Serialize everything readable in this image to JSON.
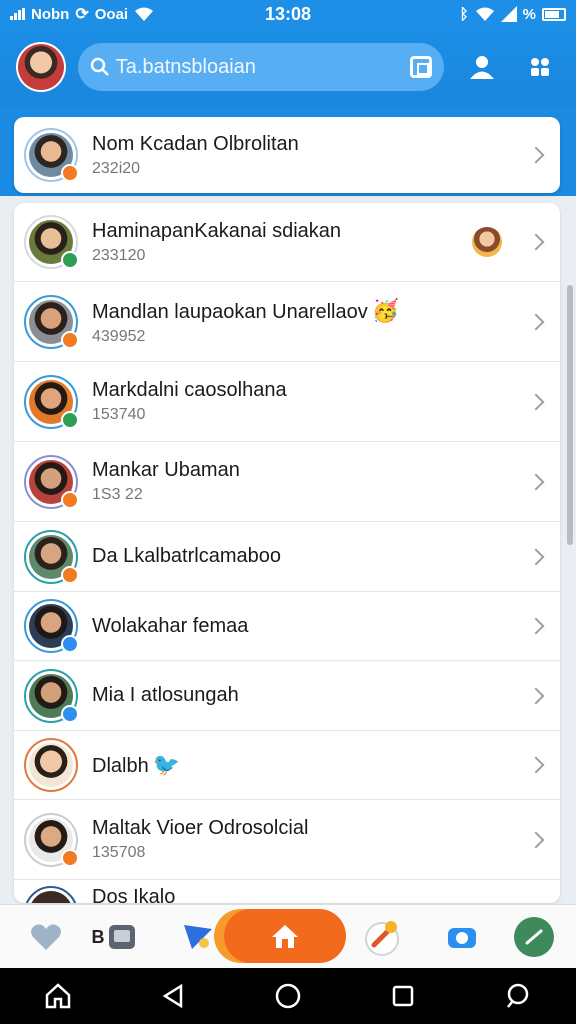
{
  "status_bar": {
    "carrier": "Nobn",
    "carrier2": "Ooai",
    "time": "13:08",
    "battery_text": "%"
  },
  "header": {
    "search_text": "Ta.batnsbloaian"
  },
  "pinned": {
    "name": "Nom Kcadan Olbrolitan",
    "sub": "232i20"
  },
  "contacts": [
    {
      "name": "HaminapanKakanai sdiakan",
      "sub": "233120"
    },
    {
      "name": "Mandlan laupaokan Unarellaov",
      "sub": "439952"
    },
    {
      "name": "Markdalni caosolhana",
      "sub": "153740"
    },
    {
      "name": "Mankar Ubaman",
      "sub": "1S3 22"
    },
    {
      "name": "Da Lkalbatrlcamaboo",
      "sub": ""
    },
    {
      "name": "Wolakahar femaa",
      "sub": ""
    },
    {
      "name": "Mia I atlosungah",
      "sub": ""
    },
    {
      "name": "Dlalbh",
      "sub": ""
    },
    {
      "name": "Maltak Vioer Odrosolcial",
      "sub": "135708"
    },
    {
      "name": "Dos Ikalo",
      "sub": ""
    }
  ],
  "tabbar": {
    "second_label": "B"
  },
  "colors": {
    "primary": "#1d8fe6",
    "accent_orange": "#f26a1b",
    "badge_green": "#2e9e55",
    "badge_orange": "#f27a22",
    "badge_blue": "#2f8ff0"
  }
}
